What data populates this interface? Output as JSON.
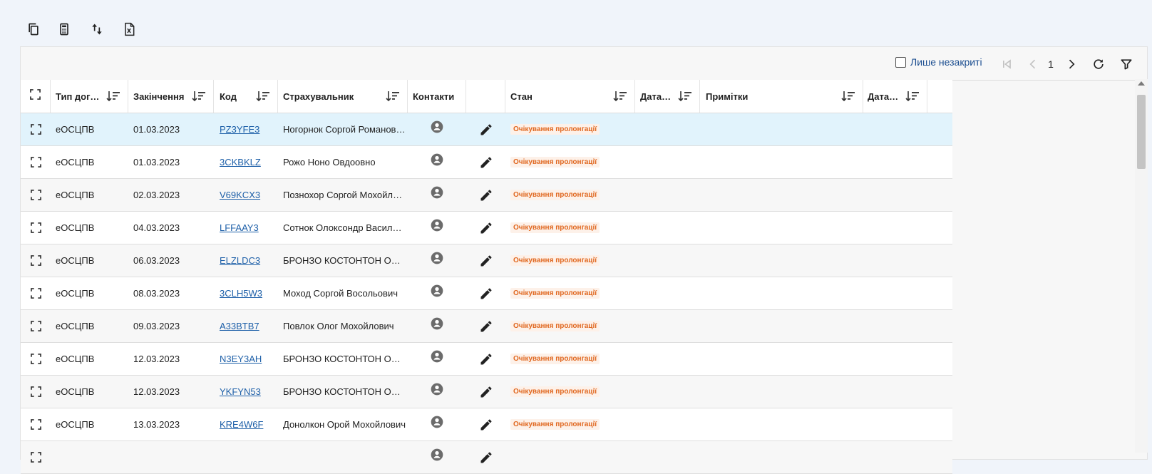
{
  "toolbar": {
    "buttons": [
      {
        "name": "copy-icon"
      },
      {
        "name": "calculator-icon"
      },
      {
        "name": "swap-vertical-icon"
      },
      {
        "name": "excel-export-icon"
      }
    ]
  },
  "filter": {
    "only_open_label": "Лише незакриті",
    "checked": false
  },
  "pagination": {
    "current_page": "1"
  },
  "columns": [
    {
      "key": "expand",
      "label": ""
    },
    {
      "key": "type",
      "label": "Тип договору"
    },
    {
      "key": "end_date",
      "label": "Закінчення"
    },
    {
      "key": "code",
      "label": "Код"
    },
    {
      "key": "insurer",
      "label": "Страхувальник"
    },
    {
      "key": "contacts",
      "label": "Контакти"
    },
    {
      "key": "edit",
      "label": ""
    },
    {
      "key": "status",
      "label": "Стан"
    },
    {
      "key": "date1",
      "label": "Дата ..."
    },
    {
      "key": "notes",
      "label": "Примітки"
    },
    {
      "key": "date2",
      "label": "Дата ..."
    }
  ],
  "rows": [
    {
      "type": "еОСЦПВ",
      "end_date": "01.03.2023",
      "code": "PZ3YFE3",
      "insurer": "Ногорнок Соргой Романович",
      "status": "Очікування пролонгації"
    },
    {
      "type": "еОСЦПВ",
      "end_date": "01.03.2023",
      "code": "3CKBKLZ",
      "insurer": "Рожо Ноно Овдоовно",
      "status": "Очікування пролонгації"
    },
    {
      "type": "еОСЦПВ",
      "end_date": "02.03.2023",
      "code": "V69KCX3",
      "insurer": "Познохор Соргой Мохойлович",
      "status": "Очікування пролонгації"
    },
    {
      "type": "еОСЦПВ",
      "end_date": "04.03.2023",
      "code": "LFFAAY3",
      "insurer": "Сотнок Олоксондр Васильович",
      "status": "Очікування пролонгації"
    },
    {
      "type": "еОСЦПВ",
      "end_date": "06.03.2023",
      "code": "ELZLDC3",
      "insurer": "БРОНЗО КОСТОНТОН ОВЕРСОН",
      "status": "Очікування пролонгації"
    },
    {
      "type": "еОСЦПВ",
      "end_date": "08.03.2023",
      "code": "3CLH5W3",
      "insurer": "Моход Соргой Восольович",
      "status": "Очікування пролонгації"
    },
    {
      "type": "еОСЦПВ",
      "end_date": "09.03.2023",
      "code": "A33BTB7",
      "insurer": "Повлок Олог Мохойлович",
      "status": "Очікування пролонгації"
    },
    {
      "type": "еОСЦПВ",
      "end_date": "12.03.2023",
      "code": "N3EY3AH",
      "insurer": "БРОНЗО КОСТОНТОН ОВЕРСОН",
      "status": "Очікування пролонгації"
    },
    {
      "type": "еОСЦПВ",
      "end_date": "12.03.2023",
      "code": "YKFYN53",
      "insurer": "БРОНЗО КОСТОНТОН ОВЕРСОН",
      "status": "Очікування пролонгації"
    },
    {
      "type": "еОСЦПВ",
      "end_date": "13.03.2023",
      "code": "KRE4W6F",
      "insurer": "Донолкон Орой Мохойлович",
      "status": "Очікування пролонгації"
    },
    {
      "type": "",
      "end_date": "",
      "code": "",
      "insurer": "",
      "status": ""
    }
  ],
  "selected_row": 0,
  "colors": {
    "accent_link": "#1d5fa8",
    "status_text": "#e0671f",
    "status_bg": "#fdf1e9",
    "selected_row": "#e1f3fc"
  }
}
